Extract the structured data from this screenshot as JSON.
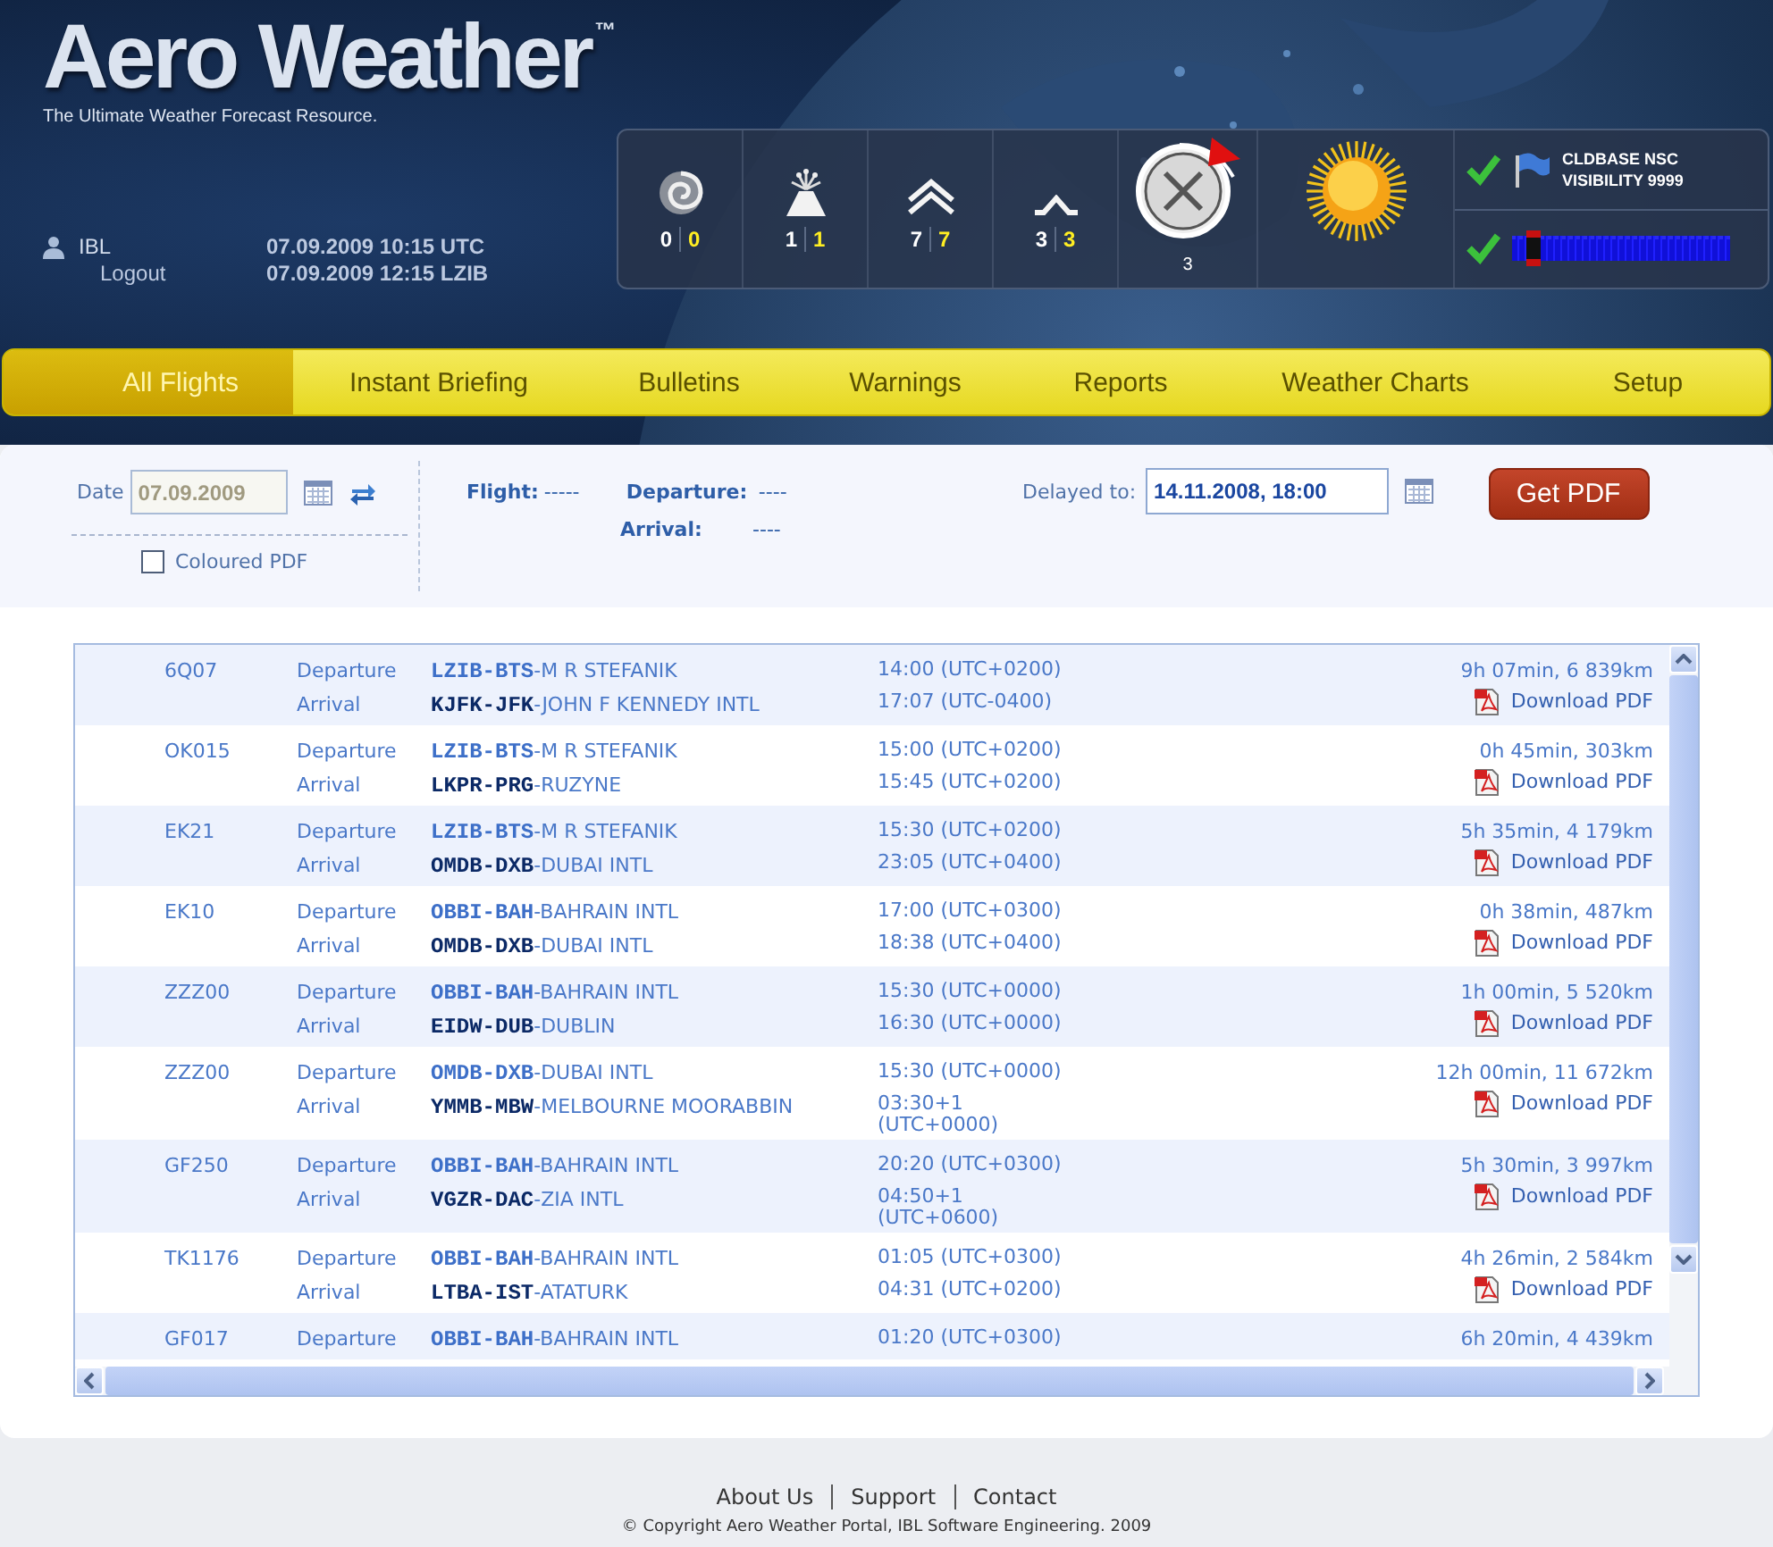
{
  "logo": {
    "name": "Aero Weather",
    "mark": "™",
    "tagline": "The Ultimate Weather Forecast Resource."
  },
  "user": {
    "name": "IBL",
    "logout": "Logout",
    "times": [
      "07.09.2009 10:15 UTC",
      "07.09.2009 12:15 LZIB"
    ]
  },
  "counters": [
    {
      "kind": "cyclone",
      "total": "0",
      "new": "0"
    },
    {
      "kind": "volcano",
      "total": "1",
      "new": "1"
    },
    {
      "kind": "double",
      "total": "7",
      "new": "7"
    },
    {
      "kind": "single",
      "total": "3",
      "new": "3"
    }
  ],
  "clock": {
    "count": "3"
  },
  "status": [
    {
      "kind": "text",
      "ok": true,
      "lines": [
        "CLDBASE NSC",
        "VISIBILITY 9999"
      ]
    },
    {
      "kind": "meter",
      "ok": true,
      "level": 0.1
    }
  ],
  "nav": [
    {
      "label": "All Flights",
      "selected": true
    },
    {
      "label": "Instant Briefing",
      "selected": false
    },
    {
      "label": "Bulletins",
      "selected": false
    },
    {
      "label": "Warnings",
      "selected": false
    },
    {
      "label": "Reports",
      "selected": false
    },
    {
      "label": "Weather Charts",
      "selected": false
    },
    {
      "label": "Setup",
      "selected": false
    }
  ],
  "filter": {
    "date_label": "Date",
    "date": {
      "value": "07.09.2009",
      "disabled": true
    },
    "coloured_pdf": {
      "label": "Coloured PDF",
      "checked": false
    },
    "flight_label": "Flight:",
    "flight": "-----",
    "departure_label": "Departure:",
    "departure": "----",
    "arrival_label": "Arrival:",
    "arrival": "----",
    "delayed_label": "Delayed to:",
    "delayed": "14.11.2008, 18:00",
    "button": "Get PDF"
  },
  "flights": [
    {
      "flight": "6Q07",
      "legs": [
        {
          "kind": "departure",
          "type": "Departure",
          "airport": "**LZIB-BTS**-M R STEFANIK",
          "time": "14:00 (UTC+0200)"
        },
        {
          "kind": "arrival",
          "type": "Arrival",
          "airport": "**KJFK-JFK**-JOHN F KENNEDY INTL",
          "time": "17:07 (UTC-0400)"
        }
      ],
      "summary": "9h 07min, 6 839km",
      "download": "Download PDF"
    },
    {
      "flight": "OK015",
      "legs": [
        {
          "kind": "departure",
          "type": "Departure",
          "airport": "**LZIB-BTS**-M R STEFANIK",
          "time": "15:00 (UTC+0200)"
        },
        {
          "kind": "arrival",
          "type": "Arrival",
          "airport": "**LKPR-PRG**-RUZYNE",
          "time": "15:45 (UTC+0200)"
        }
      ],
      "summary": "0h 45min, 303km",
      "download": "Download PDF"
    },
    {
      "flight": "EK21",
      "legs": [
        {
          "kind": "departure",
          "type": "Departure",
          "airport": "**LZIB-BTS**-M R STEFANIK",
          "time": "15:30 (UTC+0200)"
        },
        {
          "kind": "arrival",
          "type": "Arrival",
          "airport": "**OMDB-DXB**-DUBAI INTL",
          "time": "23:05 (UTC+0400)"
        }
      ],
      "summary": "5h 35min, 4 179km",
      "download": "Download PDF"
    },
    {
      "flight": "EK10",
      "legs": [
        {
          "kind": "departure",
          "type": "Departure",
          "airport": "**OBBI-BAH**-BAHRAIN INTL",
          "time": "17:00 (UTC+0300)"
        },
        {
          "kind": "arrival",
          "type": "Arrival",
          "airport": "**OMDB-DXB**-DUBAI INTL",
          "time": "18:38 (UTC+0400)"
        }
      ],
      "summary": "0h 38min, 487km",
      "download": "Download PDF"
    },
    {
      "flight": "ZZZ00",
      "legs": [
        {
          "kind": "departure",
          "type": "Departure",
          "airport": "**OBBI-BAH**-BAHRAIN INTL",
          "time": "15:30 (UTC+0000)"
        },
        {
          "kind": "arrival",
          "type": "Arrival",
          "airport": "**EIDW-DUB**-DUBLIN",
          "time": "16:30 (UTC+0000)"
        }
      ],
      "summary": "1h 00min, 5 520km",
      "download": "Download PDF"
    },
    {
      "flight": "ZZZ00",
      "legs": [
        {
          "kind": "departure",
          "type": "Departure",
          "airport": "**OMDB-DXB**-DUBAI INTL",
          "time": "15:30 (UTC+0000)"
        },
        {
          "kind": "arrival",
          "type": "Arrival",
          "airport": "**YMMB-MBW**-MELBOURNE MOORABBIN",
          "time": "03:30+1 (UTC+0000)"
        }
      ],
      "summary": "12h 00min, 11 672km",
      "download": "Download PDF"
    },
    {
      "flight": "GF250",
      "legs": [
        {
          "kind": "departure",
          "type": "Departure",
          "airport": "**OBBI-BAH**-BAHRAIN INTL",
          "time": "20:20 (UTC+0300)"
        },
        {
          "kind": "arrival",
          "type": "Arrival",
          "airport": "**VGZR-DAC**-ZIA INTL",
          "time": "04:50+1 (UTC+0600)"
        }
      ],
      "summary": "5h 30min, 3 997km",
      "download": "Download PDF"
    },
    {
      "flight": "TK1176",
      "legs": [
        {
          "kind": "departure",
          "type": "Departure",
          "airport": "**OBBI-BAH**-BAHRAIN INTL",
          "time": "01:05 (UTC+0300)"
        },
        {
          "kind": "arrival",
          "type": "Arrival",
          "airport": "**LTBA-IST**-ATATURK",
          "time": "04:31 (UTC+0200)"
        }
      ],
      "summary": "4h 26min, 2 584km",
      "download": "Download PDF"
    },
    {
      "flight": "GF017",
      "legs": [
        {
          "kind": "departure",
          "type": "Departure",
          "airport": "**OBBI-BAH**-BAHRAIN INTL",
          "time": "01:20 (UTC+0300)"
        }
      ],
      "summary": "6h 20min, 4 439km"
    }
  ],
  "footer": {
    "links": [
      "About Us",
      "Support",
      "Contact"
    ],
    "copyright": "© Copyright Aero Weather Portal, IBL Software Engineering. 2009"
  }
}
